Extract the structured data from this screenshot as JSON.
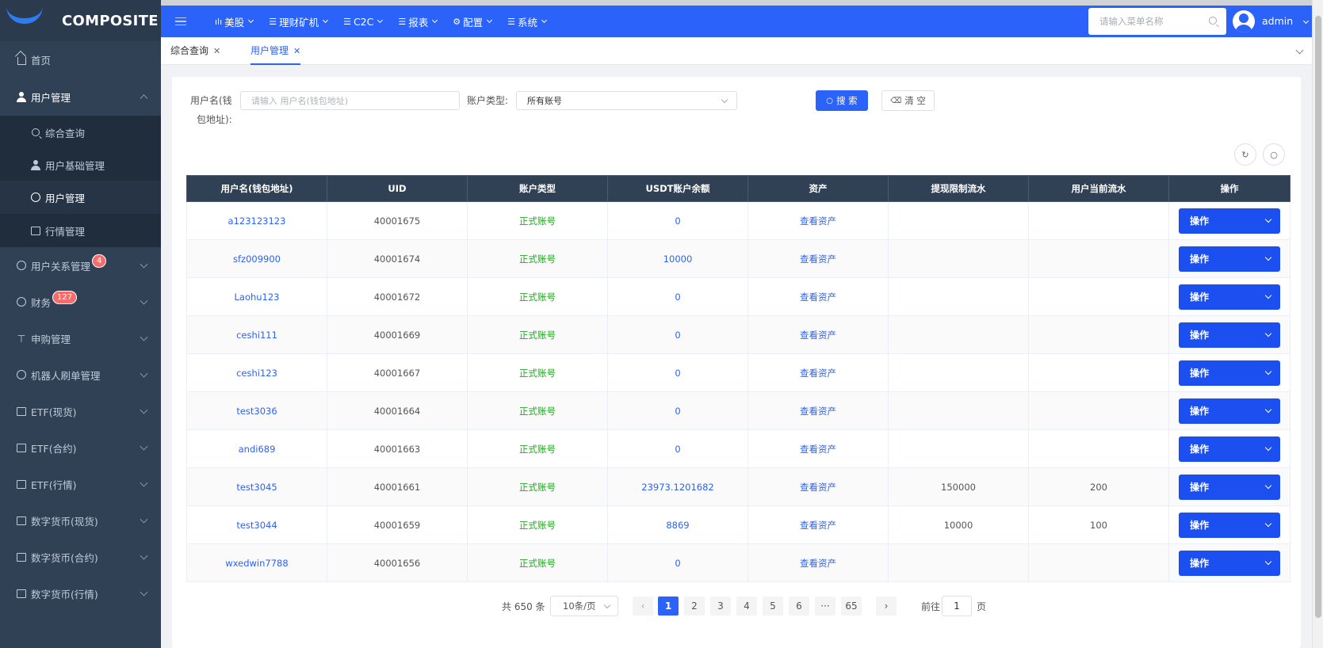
{
  "app": {
    "logo_text": "COMPOSITE"
  },
  "sidebar": {
    "home": "首页",
    "user_mgmt": "用户管理",
    "sub": [
      "综合查询",
      "用户基础管理",
      "用户管理",
      "行情管理"
    ],
    "items": [
      {
        "label": "用户关系管理",
        "badge": "4"
      },
      {
        "label": "财务",
        "badge": "127"
      },
      {
        "label": "申购管理"
      },
      {
        "label": "机器人刷单管理"
      },
      {
        "label": "ETF(现货)"
      },
      {
        "label": "ETF(合约)"
      },
      {
        "label": "ETF(行情)"
      },
      {
        "label": "数字货币(现货)"
      },
      {
        "label": "数字货币(合约)"
      },
      {
        "label": "数字货币(行情)"
      }
    ]
  },
  "topnav": {
    "items": [
      "美股",
      "理财矿机",
      "C2C",
      "报表",
      "配置",
      "系统"
    ],
    "icons": [
      "chart-icon",
      "list-icon",
      "list-icon",
      "list-icon",
      "gear-icon",
      "list-icon"
    ],
    "menu_search_placeholder": "请输入菜单名称",
    "user": "admin"
  },
  "tabs": [
    {
      "label": "综合查询"
    },
    {
      "label": "用户管理",
      "active": true
    }
  ],
  "filters": {
    "username_label_1": "用户名(钱",
    "username_label_2": "包地址):",
    "username_placeholder": "请输入 用户名(钱包地址)",
    "account_type_label": "账户类型:",
    "account_type_value": "所有账号",
    "search_btn": "搜 索",
    "clear_btn": "清 空"
  },
  "table": {
    "headers": [
      "用户名(钱包地址)",
      "UID",
      "账户类型",
      "USDT账户余额",
      "资产",
      "提现限制流水",
      "用户当前流水",
      "操作"
    ],
    "view_asset": "查看资产",
    "op_label": "操作",
    "rows": [
      {
        "name": "a123123123",
        "uid": "40001675",
        "type": "正式账号",
        "usdt": "0",
        "limit": "",
        "current": ""
      },
      {
        "name": "sfz009900",
        "uid": "40001674",
        "type": "正式账号",
        "usdt": "10000",
        "limit": "",
        "current": ""
      },
      {
        "name": "Laohu123",
        "uid": "40001672",
        "type": "正式账号",
        "usdt": "0",
        "limit": "",
        "current": ""
      },
      {
        "name": "ceshi111",
        "uid": "40001669",
        "type": "正式账号",
        "usdt": "0",
        "limit": "",
        "current": ""
      },
      {
        "name": "ceshi123",
        "uid": "40001667",
        "type": "正式账号",
        "usdt": "0",
        "limit": "",
        "current": ""
      },
      {
        "name": "test3036",
        "uid": "40001664",
        "type": "正式账号",
        "usdt": "0",
        "limit": "",
        "current": ""
      },
      {
        "name": "andi689",
        "uid": "40001663",
        "type": "正式账号",
        "usdt": "0",
        "limit": "",
        "current": ""
      },
      {
        "name": "test3045",
        "uid": "40001661",
        "type": "正式账号",
        "usdt": "23973.1201682",
        "limit": "150000",
        "current": "200"
      },
      {
        "name": "test3044",
        "uid": "40001659",
        "type": "正式账号",
        "usdt": "8869",
        "limit": "10000",
        "current": "100"
      },
      {
        "name": "wxedwin7788",
        "uid": "40001656",
        "type": "正式账号",
        "usdt": "0",
        "limit": "",
        "current": ""
      }
    ]
  },
  "pagination": {
    "total": "共 650 条",
    "page_size": "10条/页",
    "pages": [
      "1",
      "2",
      "3",
      "4",
      "5",
      "6",
      "···",
      "65"
    ],
    "current": "1",
    "goto_label": "前往",
    "goto_value": "1",
    "page_suffix": "页"
  },
  "colors": {
    "primary": "#2a62fa",
    "sidebar_bg": "#304156",
    "success": "#29a329",
    "badge": "#f56c6c"
  }
}
